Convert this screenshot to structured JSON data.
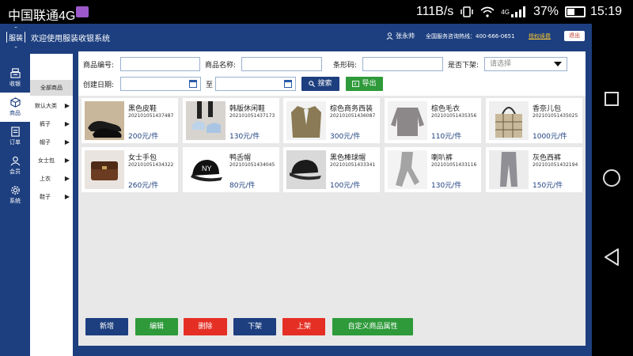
{
  "status_bar": {
    "carrier": "中国联通4G",
    "net_speed": "111B/s",
    "network": "4G",
    "battery": "37%",
    "time": "15:19"
  },
  "header": {
    "logo_text": "服装",
    "title": "欢迎使用服装收银系统",
    "user": "张永帅",
    "hotline": "全国服务咨询热线：400-666-0651",
    "license": "授权续费",
    "logout": "退出"
  },
  "left_nav": [
    {
      "label": "收银",
      "icon": "register-icon"
    },
    {
      "label": "商品",
      "icon": "cube-icon"
    },
    {
      "label": "订单",
      "icon": "order-icon"
    },
    {
      "label": "会员",
      "icon": "member-icon"
    },
    {
      "label": "系统",
      "icon": "gear-icon"
    }
  ],
  "categories": {
    "all": "全部商品",
    "items": [
      {
        "label": "默认大类",
        "arrow": "▶"
      },
      {
        "label": "裤子",
        "arrow": "▶"
      },
      {
        "label": "帽子",
        "arrow": "▶"
      },
      {
        "label": "女士包",
        "arrow": "▶"
      },
      {
        "label": "上衣",
        "arrow": "▶"
      },
      {
        "label": "鞋子",
        "arrow": "▶"
      }
    ]
  },
  "filters": {
    "product_no_label": "商品编号:",
    "product_name_label": "商品名称:",
    "barcode_label": "条形码:",
    "listed_label": "是否下架:",
    "listed_placeholder": "请选择",
    "created_label": "创建日期:",
    "to_label": "至",
    "search_button": "搜索",
    "export_button": "导出"
  },
  "products": [
    {
      "name": "黑色皮鞋",
      "code": "202101051437487",
      "price": "200元/件",
      "icon": "leather-shoes-image"
    },
    {
      "name": "韩版休闲鞋",
      "code": "202101051437173",
      "price": "130元/件",
      "icon": "casual-shoes-image"
    },
    {
      "name": "棕色商务西装",
      "code": "202101051436087",
      "price": "300元/件",
      "icon": "suit-image"
    },
    {
      "name": "棕色毛衣",
      "code": "202101051435356",
      "price": "110元/件",
      "icon": "sweater-image"
    },
    {
      "name": "香奈儿包",
      "code": "202101051435025",
      "price": "1000元/件",
      "icon": "tote-bag-image"
    },
    {
      "name": "女士手包",
      "code": "202101051434322",
      "price": "260元/件",
      "icon": "handbag-image"
    },
    {
      "name": "鸭舌帽",
      "code": "202101051434045",
      "price": "80元/件",
      "icon": "baseball-cap-image"
    },
    {
      "name": "黑色棒球帽",
      "code": "202101051433341",
      "price": "100元/件",
      "icon": "black-cap-image"
    },
    {
      "name": "喇叭裤",
      "code": "202101051433116",
      "price": "130元/件",
      "icon": "flare-pants-image"
    },
    {
      "name": "灰色西裤",
      "code": "202101051432194",
      "price": "150元/件",
      "icon": "grey-trousers-image"
    }
  ],
  "actions": {
    "add": "新增",
    "edit": "编辑",
    "delete": "删除",
    "unlist": "下架",
    "list": "上架",
    "custom_attr": "自定义商品属性"
  },
  "colors": {
    "primary": "#1d3f7f",
    "green": "#2e9a3a",
    "red": "#e52f25"
  }
}
